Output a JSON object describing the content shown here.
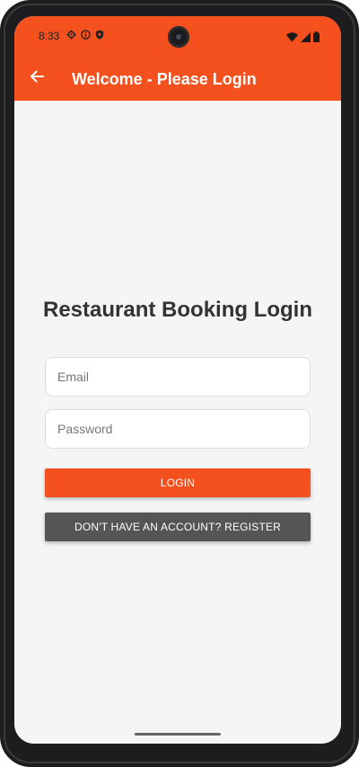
{
  "status_bar": {
    "time": "8:33",
    "left_icons": [
      "settings-icon",
      "info-icon",
      "shield-icon"
    ],
    "right_icons": [
      "wifi-icon",
      "signal-icon",
      "battery-icon"
    ]
  },
  "app_bar": {
    "title": "Welcome - Please Login",
    "back_icon": "arrow-back-icon",
    "color": "#f4511e"
  },
  "login": {
    "heading": "Restaurant Booking Login",
    "email_placeholder": "Email",
    "password_placeholder": "Password",
    "login_label": "LOGIN",
    "register_label": "DON'T HAVE AN ACCOUNT? REGISTER"
  },
  "colors": {
    "primary": "#f4511e",
    "secondary_button": "#555555",
    "background": "#f5f5f5",
    "heading_text": "#333333"
  }
}
